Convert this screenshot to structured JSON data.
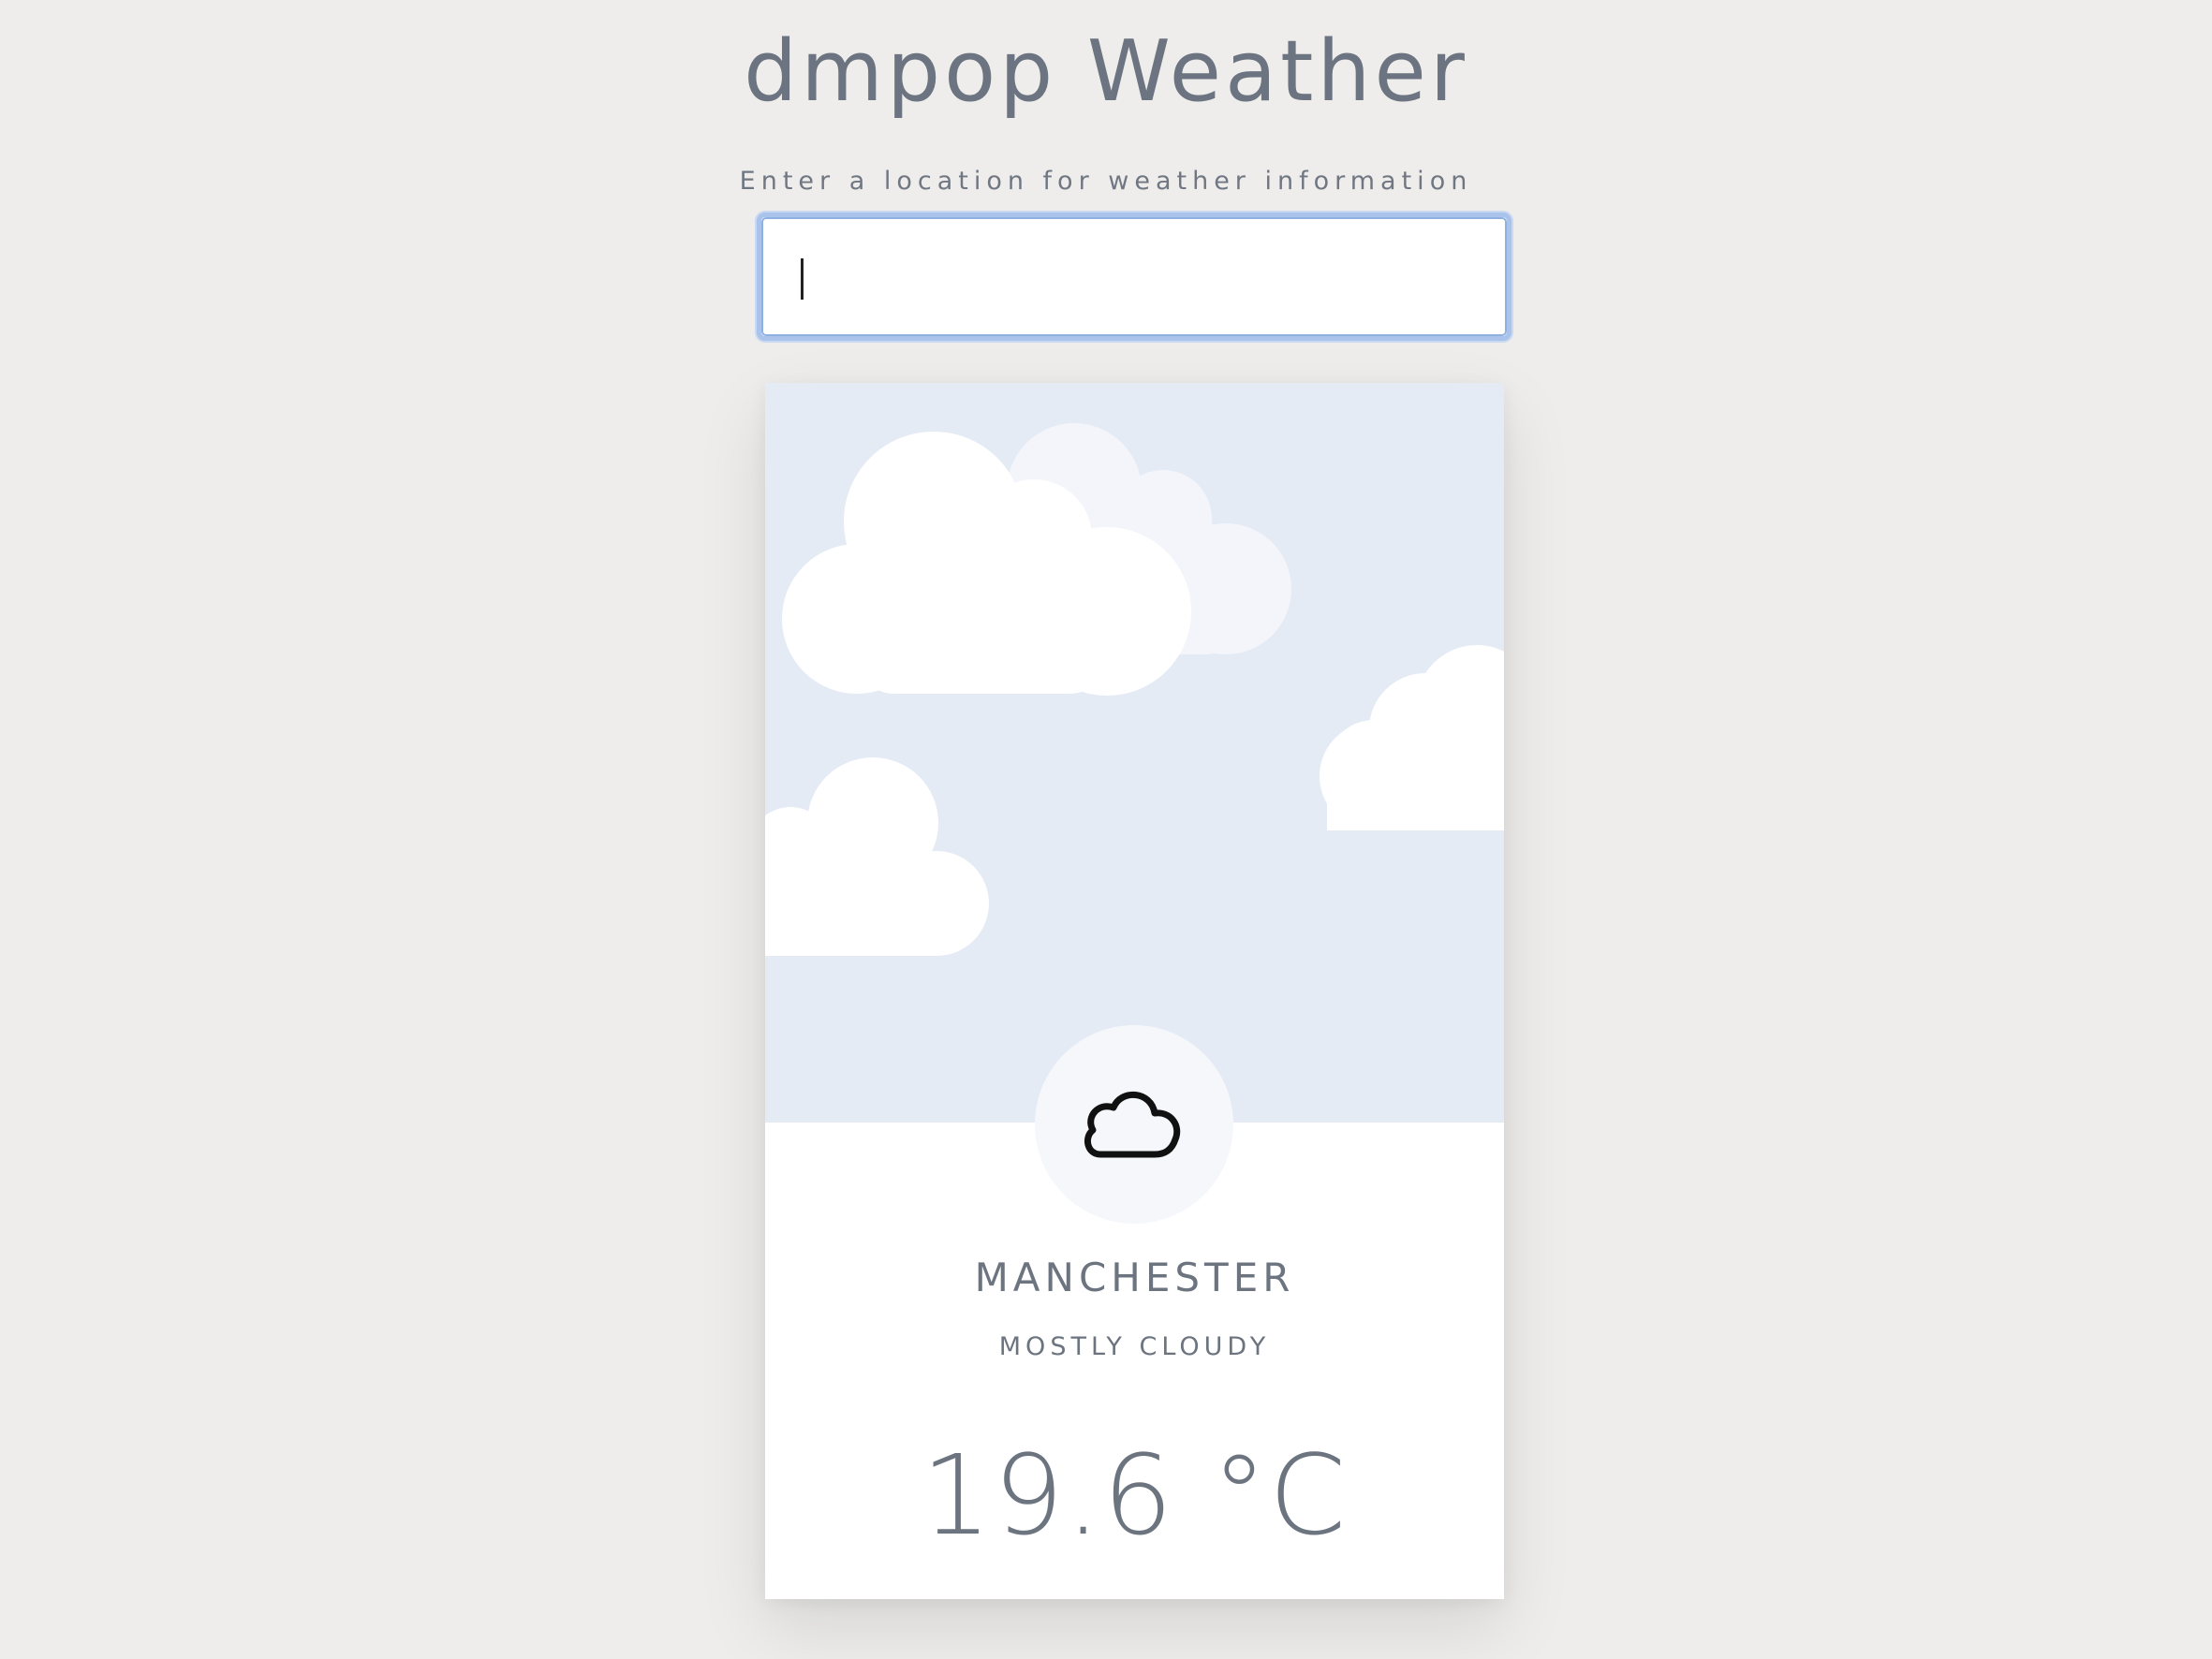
{
  "header": {
    "title": "dmpop Weather",
    "prompt": "Enter a location for weather information"
  },
  "search": {
    "value": "",
    "placeholder": ""
  },
  "weather": {
    "city": "MANCHESTER",
    "condition": "MOSTLY CLOUDY",
    "temperature": "19.6 °C",
    "icon": "cloud-icon"
  },
  "colors": {
    "background": "#eeedeb",
    "sky": "#e5ebf5",
    "text": "#6c7480",
    "focus_ring": "#a9c3ea"
  }
}
